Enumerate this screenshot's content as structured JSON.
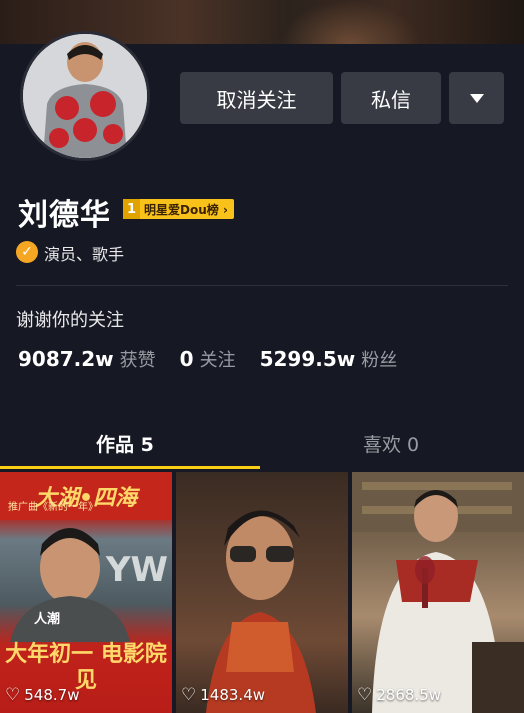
{
  "profile": {
    "name": "刘德华",
    "rank_badge_num": "1",
    "rank_badge_text": "明星爱Dou榜 ›",
    "verify_text": "演员、歌手",
    "bio": "谢谢你的关注"
  },
  "actions": {
    "unfollow_label": "取消关注",
    "message_label": "私信"
  },
  "stats": [
    {
      "value": "9087.2w",
      "label": "获赞"
    },
    {
      "value": "0",
      "label": "关注"
    },
    {
      "value": "5299.5w",
      "label": "粉丝"
    }
  ],
  "tabs": {
    "works": "作品 5",
    "likes": "喜欢 0"
  },
  "videos": [
    {
      "count": "548.7w",
      "poster_title": "大湖•四海",
      "poster_sub": "推广曲《新的一年》",
      "poster_tag": "人潮",
      "poster_bottom": "大年初一 电影院见",
      "poster_mark": "YW"
    },
    {
      "count": "1483.4w"
    },
    {
      "count": "2868.5w"
    }
  ],
  "icons": [
    "chevron-down-icon",
    "verified-icon",
    "heart-icon"
  ],
  "colors": {
    "background": "#161823",
    "button": "#393b44",
    "accent": "#face15",
    "badge": "#f8c21b",
    "verify": "#f5a623"
  }
}
